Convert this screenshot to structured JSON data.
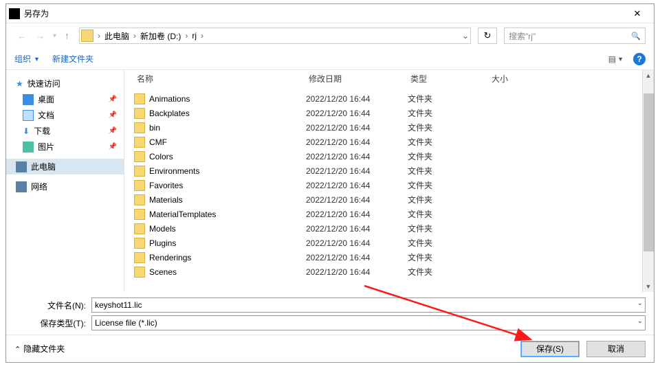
{
  "titlebar": {
    "title": "另存为"
  },
  "breadcrumb": {
    "root": "此电脑",
    "drive": "新加卷 (D:)",
    "folder": "rj"
  },
  "search": {
    "placeholder": "搜索\"rj\""
  },
  "toolbar": {
    "organize": "组织",
    "newfolder": "新建文件夹"
  },
  "sidebar": {
    "quick": "快速访问",
    "desktop": "桌面",
    "docs": "文档",
    "downloads": "下载",
    "pictures": "图片",
    "thispc": "此电脑",
    "network": "网络"
  },
  "columns": {
    "name": "名称",
    "date": "修改日期",
    "type": "类型",
    "size": "大小"
  },
  "rows": [
    {
      "name": "Animations",
      "date": "2022/12/20 16:44",
      "type": "文件夹"
    },
    {
      "name": "Backplates",
      "date": "2022/12/20 16:44",
      "type": "文件夹"
    },
    {
      "name": "bin",
      "date": "2022/12/20 16:44",
      "type": "文件夹"
    },
    {
      "name": "CMF",
      "date": "2022/12/20 16:44",
      "type": "文件夹"
    },
    {
      "name": "Colors",
      "date": "2022/12/20 16:44",
      "type": "文件夹"
    },
    {
      "name": "Environments",
      "date": "2022/12/20 16:44",
      "type": "文件夹"
    },
    {
      "name": "Favorites",
      "date": "2022/12/20 16:44",
      "type": "文件夹"
    },
    {
      "name": "Materials",
      "date": "2022/12/20 16:44",
      "type": "文件夹"
    },
    {
      "name": "MaterialTemplates",
      "date": "2022/12/20 16:44",
      "type": "文件夹"
    },
    {
      "name": "Models",
      "date": "2022/12/20 16:44",
      "type": "文件夹"
    },
    {
      "name": "Plugins",
      "date": "2022/12/20 16:44",
      "type": "文件夹"
    },
    {
      "name": "Renderings",
      "date": "2022/12/20 16:44",
      "type": "文件夹"
    },
    {
      "name": "Scenes",
      "date": "2022/12/20 16:44",
      "type": "文件夹"
    }
  ],
  "form": {
    "filename_label": "文件名(N):",
    "filename_value": "keyshot11.lic",
    "filetype_label": "保存类型(T):",
    "filetype_value": "License file (*.lic)"
  },
  "footer": {
    "hidefolders": "隐藏文件夹",
    "save": "保存(S)",
    "cancel": "取消"
  }
}
